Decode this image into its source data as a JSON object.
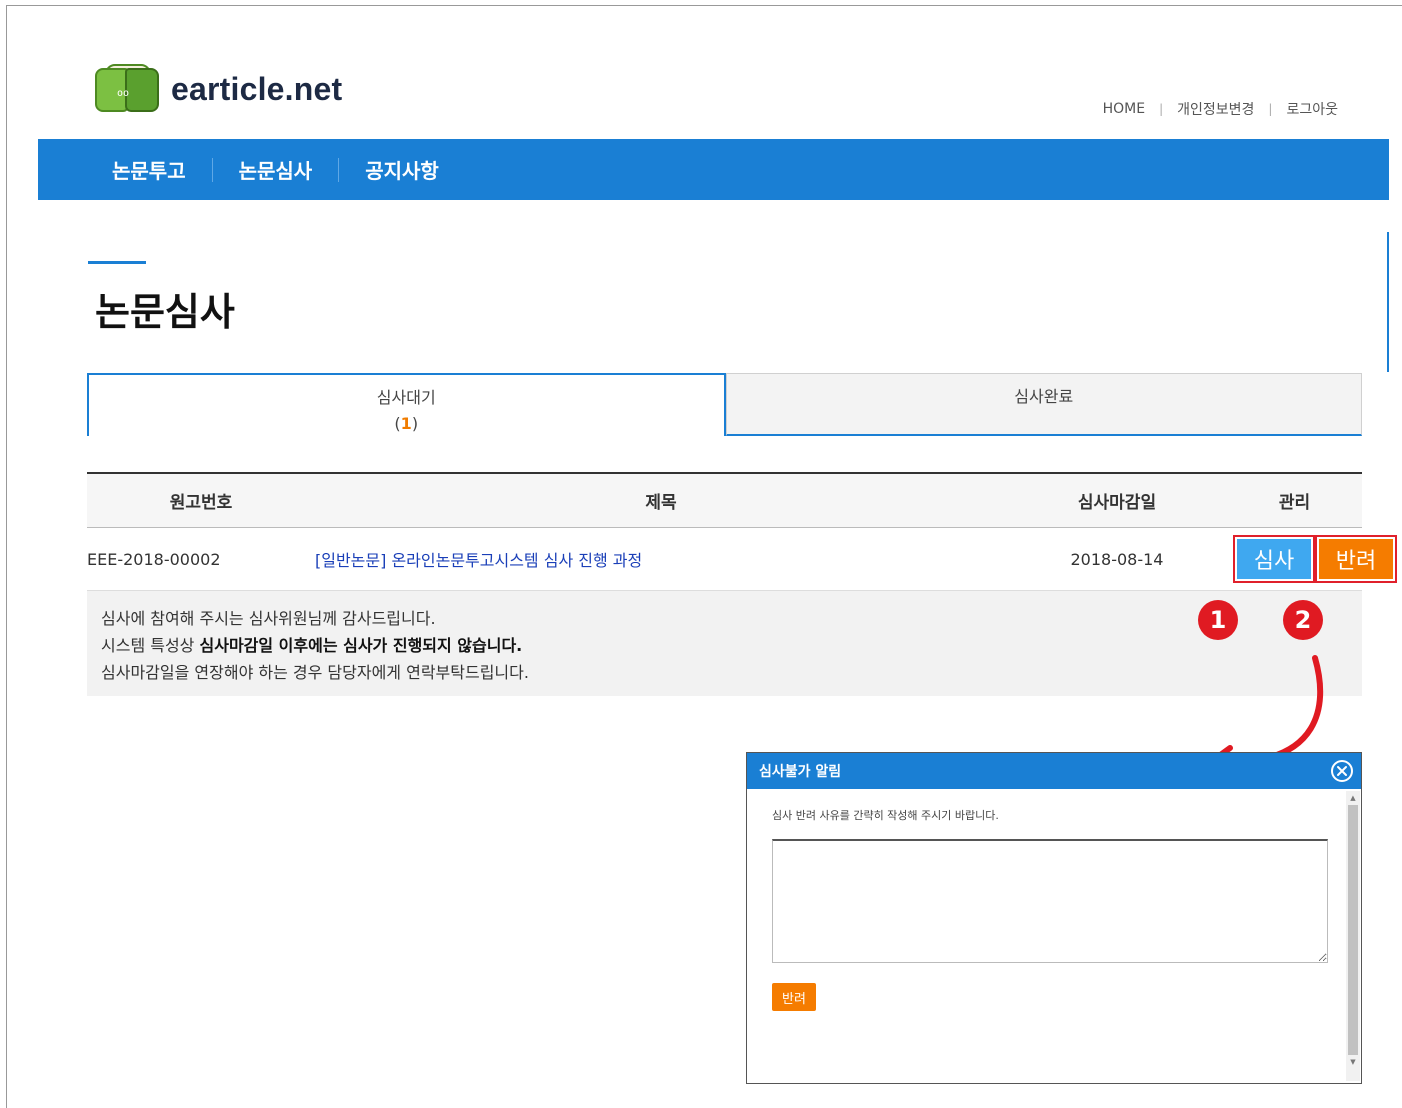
{
  "header": {
    "logo_text": "earticle.net",
    "links": [
      "HOME",
      "개인정보변경",
      "로그아웃"
    ]
  },
  "nav": {
    "items": [
      "논문투고",
      "논문심사",
      "공지사항"
    ]
  },
  "page": {
    "title": "논문심사"
  },
  "tabs": [
    {
      "label": "심사대기",
      "count_open": "(",
      "count": "1",
      "count_close": ")"
    },
    {
      "label": "심사완료"
    }
  ],
  "table": {
    "headers": [
      "원고번호",
      "제목",
      "심사마감일",
      "관리"
    ],
    "rows": [
      {
        "id": "EEE-2018-00002",
        "title": "[일반논문] 온라인논문투고시스템 심사 진행 과정",
        "deadline": "2018-08-14",
        "review_label": "심사",
        "return_label": "반려"
      }
    ]
  },
  "notice": {
    "line1": "심사에 참여해 주시는 심사위원님께 감사드립니다.",
    "line2_prefix": "시스템 특성상 ",
    "line2_bold": "심사마감일 이후에는 심사가 진행되지 않습니다.",
    "line3": "심사마감일을 연장해야 하는 경우 담당자에게 연락부탁드립니다."
  },
  "markers": [
    "1",
    "2"
  ],
  "modal": {
    "title": "심사불가 알림",
    "message": "심사 반려 사유를 간략히 작성해 주시기 바랍니다.",
    "textarea_value": "",
    "button_label": "반려"
  },
  "colors": {
    "primary": "#1a7fd4",
    "review_button": "#3fa8f0",
    "return_button": "#f57c00",
    "marker": "#e01a22",
    "link": "#1a3fb8"
  }
}
